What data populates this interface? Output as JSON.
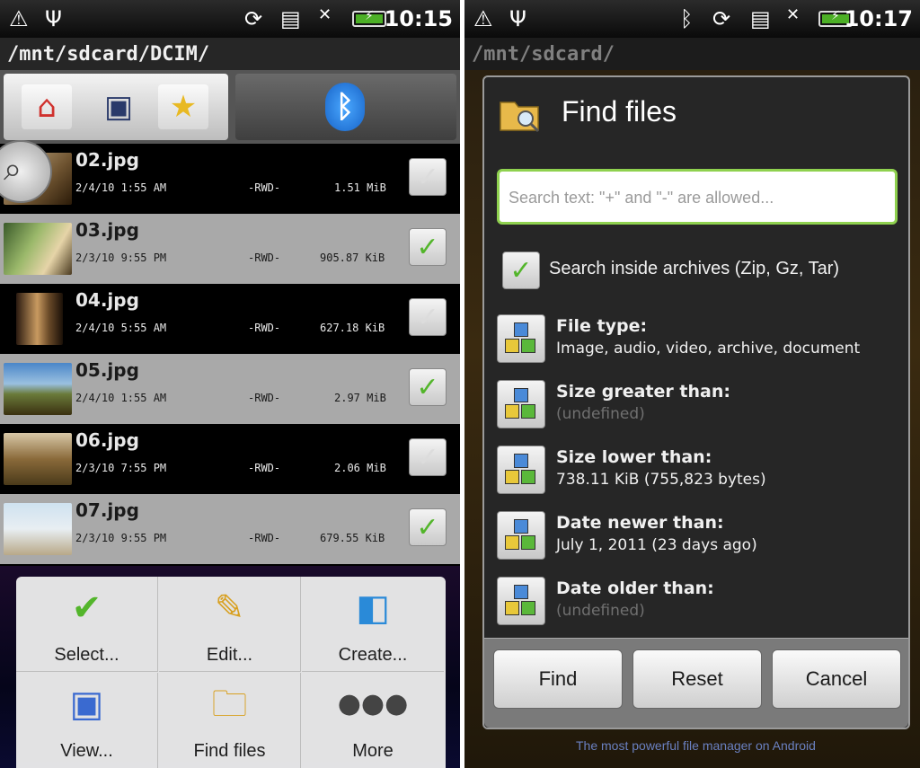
{
  "left": {
    "status": {
      "clock": "10:15"
    },
    "path": "/mnt/sdcard/DCIM/",
    "files": [
      {
        "name": "02.jpg",
        "date": "2/4/10 1:55 AM",
        "perm": "-RWD-",
        "size": "1.51 MiB",
        "selected": false
      },
      {
        "name": "03.jpg",
        "date": "2/3/10 9:55 PM",
        "perm": "-RWD-",
        "size": "905.87 KiB",
        "selected": true
      },
      {
        "name": "04.jpg",
        "date": "2/4/10 5:55 AM",
        "perm": "-RWD-",
        "size": "627.18 KiB",
        "selected": false
      },
      {
        "name": "05.jpg",
        "date": "2/4/10 1:55 AM",
        "perm": "-RWD-",
        "size": "2.97 MiB",
        "selected": true
      },
      {
        "name": "06.jpg",
        "date": "2/3/10 7:55 PM",
        "perm": "-RWD-",
        "size": "2.06 MiB",
        "selected": false
      },
      {
        "name": "07.jpg",
        "date": "2/3/10 9:55 PM",
        "perm": "-RWD-",
        "size": "679.55 KiB",
        "selected": true
      }
    ],
    "menu": {
      "select": "Select...",
      "edit": "Edit...",
      "create": "Create...",
      "view": "View...",
      "find": "Find files",
      "more": "More"
    }
  },
  "right": {
    "status": {
      "clock": "10:17"
    },
    "path": "/mnt/sdcard/",
    "dialog": {
      "title": "Find files",
      "search_placeholder": "Search text: \"+\" and \"-\" are allowed...",
      "archives_label": "Search inside archives (Zip, Gz, Tar)",
      "filters": [
        {
          "title": "File type:",
          "value": "Image, audio, video, archive, document",
          "defined": true
        },
        {
          "title": "Size greater than:",
          "value": "(undefined)",
          "defined": false
        },
        {
          "title": "Size lower than:",
          "value": "738.11 KiB (755,823 bytes)",
          "defined": true
        },
        {
          "title": "Date newer than:",
          "value": "July 1, 2011 (23 days ago)",
          "defined": true
        },
        {
          "title": "Date older than:",
          "value": "(undefined)",
          "defined": false
        }
      ],
      "buttons": {
        "find": "Find",
        "reset": "Reset",
        "cancel": "Cancel"
      }
    },
    "promo": "The most powerful file manager on Android"
  },
  "colors": {
    "accent_green": "#53b52b",
    "search_border": "#8fd14f"
  }
}
